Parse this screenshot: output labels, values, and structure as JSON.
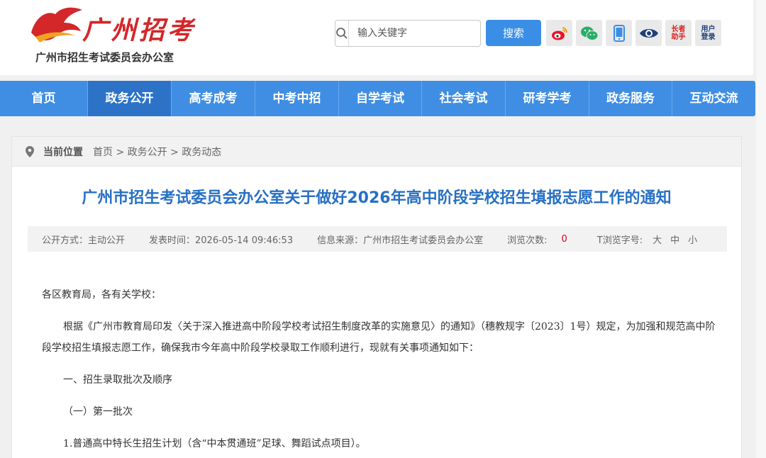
{
  "header": {
    "logo_text": "广州招考",
    "logo_subtitle": "广州市招生考试委员会办公室",
    "search_placeholder": "输入关键字",
    "search_button": "搜索",
    "icons": [
      "weibo-icon",
      "wechat-icon",
      "mobile-icon",
      "eye-icon",
      "elder-helper-icon",
      "user-login-icon"
    ],
    "elder_helper_label_1": "长者",
    "elder_helper_label_2": "助手",
    "user_login_label_1": "用户",
    "user_login_label_2": "登录"
  },
  "nav": {
    "items": [
      "首页",
      "政务公开",
      "高考成考",
      "中考中招",
      "自学考试",
      "社会考试",
      "研考学考",
      "政务服务",
      "互动交流"
    ],
    "active_index": 1
  },
  "breadcrumb": {
    "label": "当前位置",
    "path": "首页 > 政务公开 > 政务动态"
  },
  "article": {
    "title": "广州市招生考试委员会办公室关于做好2026年高中阶段学校招生填报志愿工作的通知",
    "meta": {
      "disclosure": "公开方式：主动公开",
      "publish_time": "发表时间：2026-05-14 09:46:53",
      "source": "信息来源：广州市招生考试委员会办公室",
      "views_label": "浏览次数:",
      "views_value": "0",
      "font_label": "T浏览字号:",
      "font_large": "大",
      "font_medium": "中",
      "font_small": "小"
    },
    "paragraphs": [
      "各区教育局，各有关学校：",
      "根据《广州市教育局印发〈关于深入推进高中阶段学校考试招生制度改革的实施意见〉的通知》（穗教规字〔2023〕1号）规定，为加强和规范高中阶段学校招生填报志愿工作，确保我市今年高中阶段学校录取工作顺利进行，现就有关事项通知如下：",
      "一、招生录取批次及顺序",
      "（一）第一批次",
      "1.普通高中特长生招生计划（含“中本贯通班”足球、舞蹈试点项目）。"
    ]
  },
  "colors": {
    "nav_bg": "#3f8ee3",
    "nav_active": "#2c73c8",
    "title": "#2770c4",
    "brand_red": "#d3272a",
    "views_red": "#d0021b"
  }
}
